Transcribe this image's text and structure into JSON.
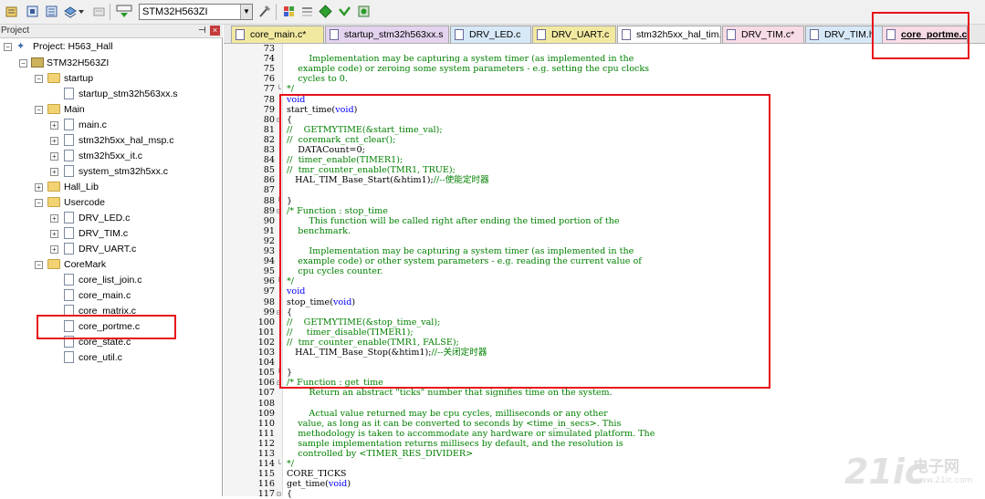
{
  "toolbar": {
    "target": "STM32H563ZI",
    "icons": [
      "translate-icon",
      "build-icon",
      "rebuild-icon",
      "batch-build-icon",
      "stop-build-icon",
      "download-icon",
      "target-options-icon",
      "manage-components-icon",
      "pack-installer-icon",
      "select-device-icon",
      "run-icon"
    ]
  },
  "project_panel": {
    "title": "Project",
    "items": [
      {
        "label": "Project: H563_Hall",
        "kind": "project"
      },
      {
        "label": "STM32H563ZI",
        "kind": "target"
      },
      {
        "label": "startup",
        "kind": "folder"
      },
      {
        "label": "startup_stm32h563xx.s",
        "kind": "file"
      },
      {
        "label": "Main",
        "kind": "folder"
      },
      {
        "label": "main.c",
        "kind": "file"
      },
      {
        "label": "stm32h5xx_hal_msp.c",
        "kind": "file"
      },
      {
        "label": "stm32h5xx_it.c",
        "kind": "file"
      },
      {
        "label": "system_stm32h5xx.c",
        "kind": "file"
      },
      {
        "label": "Hall_Lib",
        "kind": "folder"
      },
      {
        "label": "Usercode",
        "kind": "folder"
      },
      {
        "label": "DRV_LED.c",
        "kind": "file"
      },
      {
        "label": "DRV_TIM.c",
        "kind": "file"
      },
      {
        "label": "DRV_UART.c",
        "kind": "file"
      },
      {
        "label": "CoreMark",
        "kind": "folder"
      },
      {
        "label": "core_list_join.c",
        "kind": "file"
      },
      {
        "label": "core_main.c",
        "kind": "file"
      },
      {
        "label": "core_matrix.c",
        "kind": "file"
      },
      {
        "label": "core_portme.c",
        "kind": "file"
      },
      {
        "label": "core_state.c",
        "kind": "file"
      },
      {
        "label": "core_util.c",
        "kind": "file"
      }
    ]
  },
  "tabs": [
    {
      "label": "core_main.c*",
      "color": "#f2e9a0"
    },
    {
      "label": "startup_stm32h563xx.s",
      "color": "#e3d3ef"
    },
    {
      "label": "DRV_LED.c",
      "color": "#d7e8f7"
    },
    {
      "label": "DRV_UART.c",
      "color": "#f2e9a0"
    },
    {
      "label": "stm32h5xx_hal_tim.c",
      "color": "#ffffff"
    },
    {
      "label": "DRV_TIM.c*",
      "color": "#f7dbe6"
    },
    {
      "label": "DRV_TIM.h",
      "color": "#d7e8f7"
    },
    {
      "label": "core_portme.c",
      "color": "#f7dbe6"
    }
  ],
  "code": [
    {
      "n": "73",
      "fold": "",
      "parts": [
        [
          "tx",
          ""
        ]
      ]
    },
    {
      "n": "74",
      "fold": "",
      "parts": [
        [
          "cm",
          "        Implementation may be capturing a system timer (as implemented in the"
        ]
      ]
    },
    {
      "n": "75",
      "fold": "",
      "parts": [
        [
          "cm",
          "    example code) or zeroing some system parameters - e.g. setting the cpu clocks"
        ]
      ]
    },
    {
      "n": "76",
      "fold": "",
      "parts": [
        [
          "cm",
          "    cycles to 0."
        ]
      ]
    },
    {
      "n": "77",
      "fold": "└",
      "parts": [
        [
          "cm",
          "*/"
        ]
      ]
    },
    {
      "n": "78",
      "fold": "",
      "parts": [
        [
          "kw",
          "void"
        ]
      ]
    },
    {
      "n": "79",
      "fold": "",
      "parts": [
        [
          "tx",
          "start_time("
        ],
        [
          "kw",
          "void"
        ],
        [
          "tx",
          ")"
        ]
      ]
    },
    {
      "n": "80",
      "fold": "⊟",
      "parts": [
        [
          "tx",
          "{"
        ]
      ]
    },
    {
      "n": "81",
      "fold": "",
      "parts": [
        [
          "cm",
          "//    GETMYTIME(&start_time_val);"
        ]
      ]
    },
    {
      "n": "82",
      "fold": "",
      "parts": [
        [
          "cm",
          "//  coremark_cnt_clear();"
        ]
      ]
    },
    {
      "n": "83",
      "fold": "",
      "parts": [
        [
          "tx",
          "    DATACount=0;"
        ]
      ]
    },
    {
      "n": "84",
      "fold": "",
      "parts": [
        [
          "cm",
          "//  timer_enable(TIMER1);"
        ]
      ]
    },
    {
      "n": "85",
      "fold": "",
      "parts": [
        [
          "cm",
          "//  tmr_counter_enable(TMR1, TRUE);"
        ]
      ]
    },
    {
      "n": "86",
      "fold": "",
      "parts": [
        [
          "tx",
          "   HAL_TIM_Base_Start(&htim1);"
        ],
        [
          "cm",
          "//--使能定时器"
        ]
      ]
    },
    {
      "n": "87",
      "fold": "",
      "parts": [
        [
          "tx",
          ""
        ]
      ]
    },
    {
      "n": "88",
      "fold": "└",
      "parts": [
        [
          "tx",
          "}"
        ]
      ]
    },
    {
      "n": "89",
      "fold": "⊟",
      "parts": [
        [
          "cm",
          "/* Function : stop_time"
        ]
      ]
    },
    {
      "n": "90",
      "fold": "",
      "parts": [
        [
          "cm",
          "        This function will be called right after ending the timed portion of the"
        ]
      ]
    },
    {
      "n": "91",
      "fold": "",
      "parts": [
        [
          "cm",
          "    benchmark."
        ]
      ]
    },
    {
      "n": "92",
      "fold": "",
      "parts": [
        [
          "tx",
          ""
        ]
      ]
    },
    {
      "n": "93",
      "fold": "",
      "parts": [
        [
          "cm",
          "        Implementation may be capturing a system timer (as implemented in the"
        ]
      ]
    },
    {
      "n": "94",
      "fold": "",
      "parts": [
        [
          "cm",
          "    example code) or other system parameters - e.g. reading the current value of"
        ]
      ]
    },
    {
      "n": "95",
      "fold": "",
      "parts": [
        [
          "cm",
          "    cpu cycles counter."
        ]
      ]
    },
    {
      "n": "96",
      "fold": "└",
      "parts": [
        [
          "cm",
          "*/"
        ]
      ]
    },
    {
      "n": "97",
      "fold": "",
      "parts": [
        [
          "kw",
          "void"
        ]
      ]
    },
    {
      "n": "98",
      "fold": "",
      "parts": [
        [
          "tx",
          "stop_time("
        ],
        [
          "kw",
          "void"
        ],
        [
          "tx",
          ")"
        ]
      ]
    },
    {
      "n": "99",
      "fold": "⊟",
      "parts": [
        [
          "tx",
          "{"
        ]
      ]
    },
    {
      "n": "100",
      "fold": "",
      "parts": [
        [
          "cm",
          "//    GETMYTIME(&stop_time_val);"
        ]
      ]
    },
    {
      "n": "101",
      "fold": "",
      "parts": [
        [
          "cm",
          "//     timer_disable(TIMER1);"
        ]
      ]
    },
    {
      "n": "102",
      "fold": "",
      "parts": [
        [
          "cm",
          "//  tmr_counter_enable(TMR1, FALSE);"
        ]
      ]
    },
    {
      "n": "103",
      "fold": "",
      "parts": [
        [
          "tx",
          "   HAL_TIM_Base_Stop(&htim1);"
        ],
        [
          "cm",
          "//--关闭定时器"
        ]
      ]
    },
    {
      "n": "104",
      "fold": "",
      "parts": [
        [
          "tx",
          ""
        ]
      ]
    },
    {
      "n": "105",
      "fold": "└",
      "parts": [
        [
          "tx",
          "}"
        ]
      ]
    },
    {
      "n": "106",
      "fold": "⊟",
      "parts": [
        [
          "cm",
          "/* Function : get_time"
        ]
      ]
    },
    {
      "n": "107",
      "fold": "",
      "parts": [
        [
          "cm",
          "        Return an abstract \"ticks\" number that signifies time on the system."
        ]
      ]
    },
    {
      "n": "108",
      "fold": "",
      "parts": [
        [
          "tx",
          ""
        ]
      ]
    },
    {
      "n": "109",
      "fold": "",
      "parts": [
        [
          "cm",
          "        Actual value returned may be cpu cycles, milliseconds or any other"
        ]
      ]
    },
    {
      "n": "110",
      "fold": "",
      "parts": [
        [
          "cm",
          "    value, as long as it can be converted to seconds by <time_in_secs>. This"
        ]
      ]
    },
    {
      "n": "111",
      "fold": "",
      "parts": [
        [
          "cm",
          "    methodology is taken to accommodate any hardware or simulated platform. The"
        ]
      ]
    },
    {
      "n": "112",
      "fold": "",
      "parts": [
        [
          "cm",
          "    sample implementation returns millisecs by default, and the resolution is"
        ]
      ]
    },
    {
      "n": "113",
      "fold": "",
      "parts": [
        [
          "cm",
          "    controlled by <TIMER_RES_DIVIDER>"
        ]
      ]
    },
    {
      "n": "114",
      "fold": "└",
      "parts": [
        [
          "cm",
          "*/"
        ]
      ]
    },
    {
      "n": "115",
      "fold": "",
      "parts": [
        [
          "tx",
          "CORE_TICKS"
        ]
      ]
    },
    {
      "n": "116",
      "fold": "",
      "parts": [
        [
          "tx",
          "get_time("
        ],
        [
          "kw",
          "void"
        ],
        [
          "tx",
          ")"
        ]
      ]
    },
    {
      "n": "117",
      "fold": "⊟",
      "parts": [
        [
          "tx",
          "{"
        ]
      ]
    }
  ],
  "watermark": {
    "logo": "21ic",
    "cn": "电子网",
    "url": "www.21ic.com"
  }
}
